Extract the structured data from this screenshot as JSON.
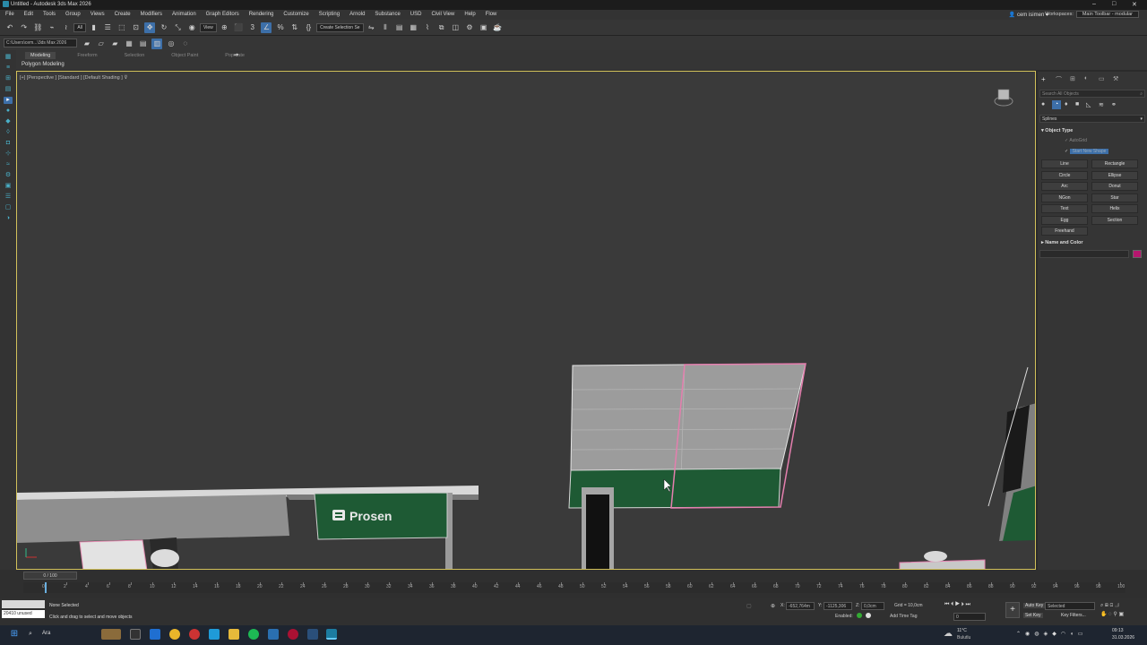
{
  "window": {
    "title": "Untitled - Autodesk 3ds Max 2026"
  },
  "menu": [
    "File",
    "Edit",
    "Tools",
    "Group",
    "Views",
    "Create",
    "Modifiers",
    "Animation",
    "Graph Editors",
    "Rendering",
    "Customize",
    "Scripting",
    "Arnold",
    "Substance",
    "USD",
    "Civil View",
    "Help",
    "Flow"
  ],
  "user": {
    "name": "cem isimen"
  },
  "workspace": {
    "label": "Workspaces:",
    "value": "Main Toolbar - modular"
  },
  "toolbar": {
    "filter": "All",
    "refcoord": "View",
    "selection_set": "Create Selection Se",
    "path": "C:\\Users\\cem...\\3ds Max 2026"
  },
  "ribbon": {
    "tabs": [
      "Modeling",
      "Freeform",
      "Selection",
      "Object Paint",
      "Populate"
    ],
    "active_tab": "Modeling",
    "sub": "Polygon Modeling"
  },
  "viewport": {
    "label": "[+] [Perspective ] [Standard ] [Default Shading ]",
    "sign_text": "Prosen"
  },
  "command_panel": {
    "search_placeholder": "Search All Objects",
    "category": "Splines",
    "object_type_title": "Object Type",
    "autogrid": "AutoGrid",
    "start_new_shape": "Start New Shape",
    "buttons": [
      "Line",
      "Rectangle",
      "Circle",
      "Ellipse",
      "Arc",
      "Donut",
      "NGon",
      "Star",
      "Text",
      "Helix",
      "Egg",
      "Section",
      "Freehand"
    ],
    "name_color_title": "Name and Color",
    "color": "#b5166e"
  },
  "timeline": {
    "frame_display": "0 / 100",
    "ticks": [
      "0",
      "2",
      "4",
      "6",
      "8",
      "10",
      "12",
      "14",
      "16",
      "18",
      "20",
      "22",
      "24",
      "26",
      "28",
      "30",
      "32",
      "34",
      "36",
      "38",
      "40",
      "42",
      "44",
      "46",
      "48",
      "50",
      "52",
      "54",
      "56",
      "58",
      "60",
      "62",
      "64",
      "66",
      "68",
      "70",
      "72",
      "74",
      "76",
      "78",
      "80",
      "82",
      "84",
      "86",
      "88",
      "90",
      "92",
      "94",
      "96",
      "98",
      "100"
    ]
  },
  "status": {
    "maxscript": "20410 unused",
    "selection": "None Selected",
    "prompt": "Click and drag to select and move objects",
    "x_label": "X:",
    "x_value": "-652,764m",
    "y_label": "Y:",
    "y_value": "-1125,306",
    "z_label": "Z:",
    "z_value": "0,0cm",
    "grid": "Grid = 10,0cm",
    "enabled": "Enabled:",
    "add_time_tag": "Add Time Tag",
    "auto_key": "Auto Key",
    "set_key": "Set Key",
    "selected": "Selected",
    "key_filters": "Key Filters...",
    "frame": "0"
  },
  "taskbar": {
    "search": "Ara",
    "weather_temp": "11°C",
    "weather_desc": "Bulutlu",
    "time": "09:13",
    "date": "31.03.2026"
  }
}
